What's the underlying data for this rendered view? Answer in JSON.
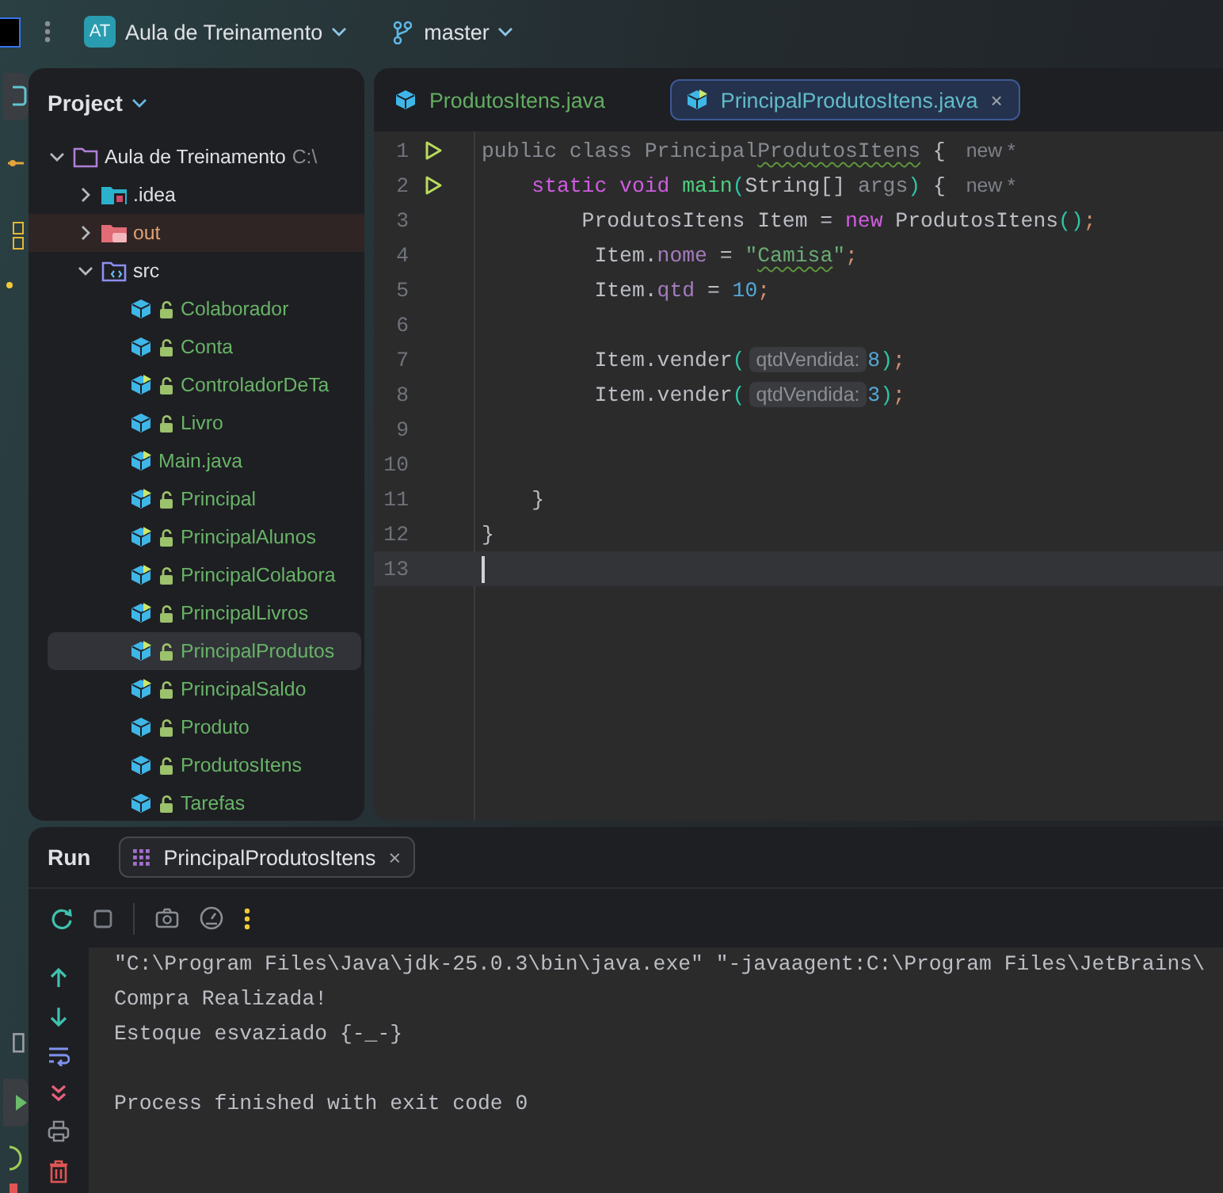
{
  "top_bar": {
    "project_badge": "AT",
    "project_name": "Aula de Treinamento",
    "branch": "master"
  },
  "project_panel": {
    "title": "Project",
    "tree": [
      {
        "label": "Aula de Treinamento",
        "path": "C:\\",
        "kind": "project",
        "expanded": true,
        "selected": false,
        "children": [
          {
            "label": ".idea",
            "kind": "idea",
            "expanded": false,
            "selected": false
          },
          {
            "label": "out",
            "kind": "excluded",
            "expanded": false,
            "selected": false
          },
          {
            "label": "src",
            "kind": "source",
            "expanded": true,
            "selected": false,
            "children": [
              {
                "label": "Colaborador",
                "kind": "class",
                "runnable": false,
                "selected": false
              },
              {
                "label": "Conta",
                "kind": "class",
                "runnable": false,
                "selected": false
              },
              {
                "label": "ControladorDeTa",
                "kind": "class",
                "runnable": true,
                "selected": false
              },
              {
                "label": "Livro",
                "kind": "class",
                "runnable": false,
                "selected": false
              },
              {
                "label": "Main.java",
                "kind": "file",
                "runnable": true,
                "selected": false
              },
              {
                "label": "Principal",
                "kind": "class",
                "runnable": true,
                "selected": false
              },
              {
                "label": "PrincipalAlunos",
                "kind": "class",
                "runnable": true,
                "selected": false
              },
              {
                "label": "PrincipalColabora",
                "kind": "class",
                "runnable": true,
                "selected": false
              },
              {
                "label": "PrincipalLivros",
                "kind": "class",
                "runnable": true,
                "selected": false
              },
              {
                "label": "PrincipalProdutos",
                "kind": "class",
                "runnable": true,
                "selected": true
              },
              {
                "label": "PrincipalSaldo",
                "kind": "class",
                "runnable": true,
                "selected": false
              },
              {
                "label": "Produto",
                "kind": "class",
                "runnable": false,
                "selected": false
              },
              {
                "label": "ProdutosItens",
                "kind": "class",
                "runnable": false,
                "selected": false
              },
              {
                "label": "Tarefas",
                "kind": "class",
                "runnable": false,
                "selected": false
              }
            ]
          }
        ]
      }
    ]
  },
  "editor": {
    "tabs": [
      {
        "label": "ProdutosItens.java",
        "runnable": false,
        "selected": false
      },
      {
        "label": "PrincipalProdutosItens.java",
        "runnable": true,
        "selected": true,
        "close": "×"
      }
    ],
    "lines": [
      {
        "number": "1",
        "run": true,
        "current": false,
        "tokens": [
          {
            "text": "public class Principal",
            "kind": "dim"
          },
          {
            "text": "ProdutosItens",
            "kind": "dim",
            "warn": true
          },
          {
            "text": " {",
            "kind": "plain"
          },
          {
            "text": "new *",
            "kind": "hint"
          }
        ]
      },
      {
        "number": "2",
        "run": true,
        "current": false,
        "tokens": [
          {
            "text": "    static",
            "kind": "keyword"
          },
          {
            "text": " void",
            "kind": "keyword"
          },
          {
            "text": " main",
            "kind": "method"
          },
          {
            "text": "(",
            "kind": "bracket"
          },
          {
            "text": "String[] ",
            "kind": "plain"
          },
          {
            "text": "args",
            "kind": "dim"
          },
          {
            "text": ")",
            "kind": "bracket"
          },
          {
            "text": " {",
            "kind": "plain"
          },
          {
            "text": "new *",
            "kind": "hint"
          }
        ]
      },
      {
        "number": "3",
        "run": false,
        "current": false,
        "tokens": [
          {
            "text": "        ProdutosItens Item = ",
            "kind": "plain"
          },
          {
            "text": "new",
            "kind": "keyword"
          },
          {
            "text": " ProdutosItens",
            "kind": "plain"
          },
          {
            "text": "()",
            "kind": "bracket"
          },
          {
            "text": ";",
            "kind": "semi"
          }
        ]
      },
      {
        "number": "4",
        "run": false,
        "current": false,
        "tokens": [
          {
            "text": "         Item.",
            "kind": "plain"
          },
          {
            "text": "nome",
            "kind": "field"
          },
          {
            "text": " = ",
            "kind": "plain"
          },
          {
            "text": "\"",
            "kind": "string"
          },
          {
            "text": "Camisa",
            "kind": "string",
            "warn": true
          },
          {
            "text": "\"",
            "kind": "string"
          },
          {
            "text": ";",
            "kind": "semi"
          }
        ]
      },
      {
        "number": "5",
        "run": false,
        "current": false,
        "tokens": [
          {
            "text": "         Item.",
            "kind": "plain"
          },
          {
            "text": "qtd",
            "kind": "field"
          },
          {
            "text": " = ",
            "kind": "plain"
          },
          {
            "text": "10",
            "kind": "number"
          },
          {
            "text": ";",
            "kind": "semi"
          }
        ]
      },
      {
        "number": "6",
        "run": false,
        "current": false
      },
      {
        "number": "7",
        "run": false,
        "current": false,
        "tokens": [
          {
            "text": "         Item.vender",
            "kind": "plain"
          },
          {
            "text": "(",
            "kind": "bracket"
          },
          {
            "text": "qtdVendida:",
            "kind": "param"
          },
          {
            "text": "8",
            "kind": "number"
          },
          {
            "text": ")",
            "kind": "bracket"
          },
          {
            "text": ";",
            "kind": "semi"
          }
        ]
      },
      {
        "number": "8",
        "run": false,
        "current": false,
        "tokens": [
          {
            "text": "         Item.vender",
            "kind": "plain"
          },
          {
            "text": "(",
            "kind": "bracket"
          },
          {
            "text": "qtdVendida:",
            "kind": "param"
          },
          {
            "text": "3",
            "kind": "number"
          },
          {
            "text": ")",
            "kind": "bracket"
          },
          {
            "text": ";",
            "kind": "semi"
          }
        ]
      },
      {
        "number": "9",
        "run": false,
        "current": false
      },
      {
        "number": "10",
        "run": false,
        "current": false
      },
      {
        "number": "11",
        "run": false,
        "current": false,
        "tokens": [
          {
            "text": "    }",
            "kind": "plain"
          }
        ]
      },
      {
        "number": "12",
        "run": false,
        "current": false,
        "tokens": [
          {
            "text": "}",
            "kind": "plain"
          }
        ]
      },
      {
        "number": "13",
        "run": false,
        "current": true
      }
    ]
  },
  "run_panel": {
    "title": "Run",
    "tabs": [
      {
        "label": "PrincipalProdutosItens",
        "close": "×",
        "selected": true
      }
    ],
    "output": [
      {
        "lines": [
          "\"C:\\Program Files\\Java\\jdk-25.0.3\\bin\\java.exe\" \"-javaagent:C:\\Program Files\\JetBrains\\",
          "Compra Realizada!",
          "Estoque esvaziado {-_-}"
        ]
      },
      {
        "lines": [
          "Process finished with exit code 0"
        ]
      }
    ]
  }
}
